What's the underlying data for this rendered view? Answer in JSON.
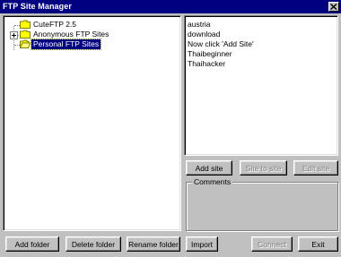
{
  "window": {
    "title": "FTP Site Manager"
  },
  "tree": {
    "items": [
      {
        "label": "CuteFTP 2.5",
        "expandable": false,
        "selected": false
      },
      {
        "label": "Anonymous FTP Sites",
        "expandable": true,
        "selected": false
      },
      {
        "label": "Personal FTP Sites",
        "expandable": false,
        "selected": true
      }
    ]
  },
  "site_list": {
    "items": [
      "austria",
      "download",
      "Now click 'Add Site'",
      "Thaibeginner",
      "Thaihacker"
    ]
  },
  "buttons": {
    "add_site": "Add site",
    "site_to_site": "Site to site",
    "edit_site": "Edit site",
    "add_folder": "Add folder",
    "delete_folder": "Delete folder",
    "rename_folder": "Rename folder",
    "import": "Import",
    "connect": "Connect",
    "exit": "Exit"
  },
  "comments": {
    "label": "Comments"
  },
  "colors": {
    "titlebar": "#000080",
    "face": "#c0c0c0",
    "selection": "#000080"
  }
}
